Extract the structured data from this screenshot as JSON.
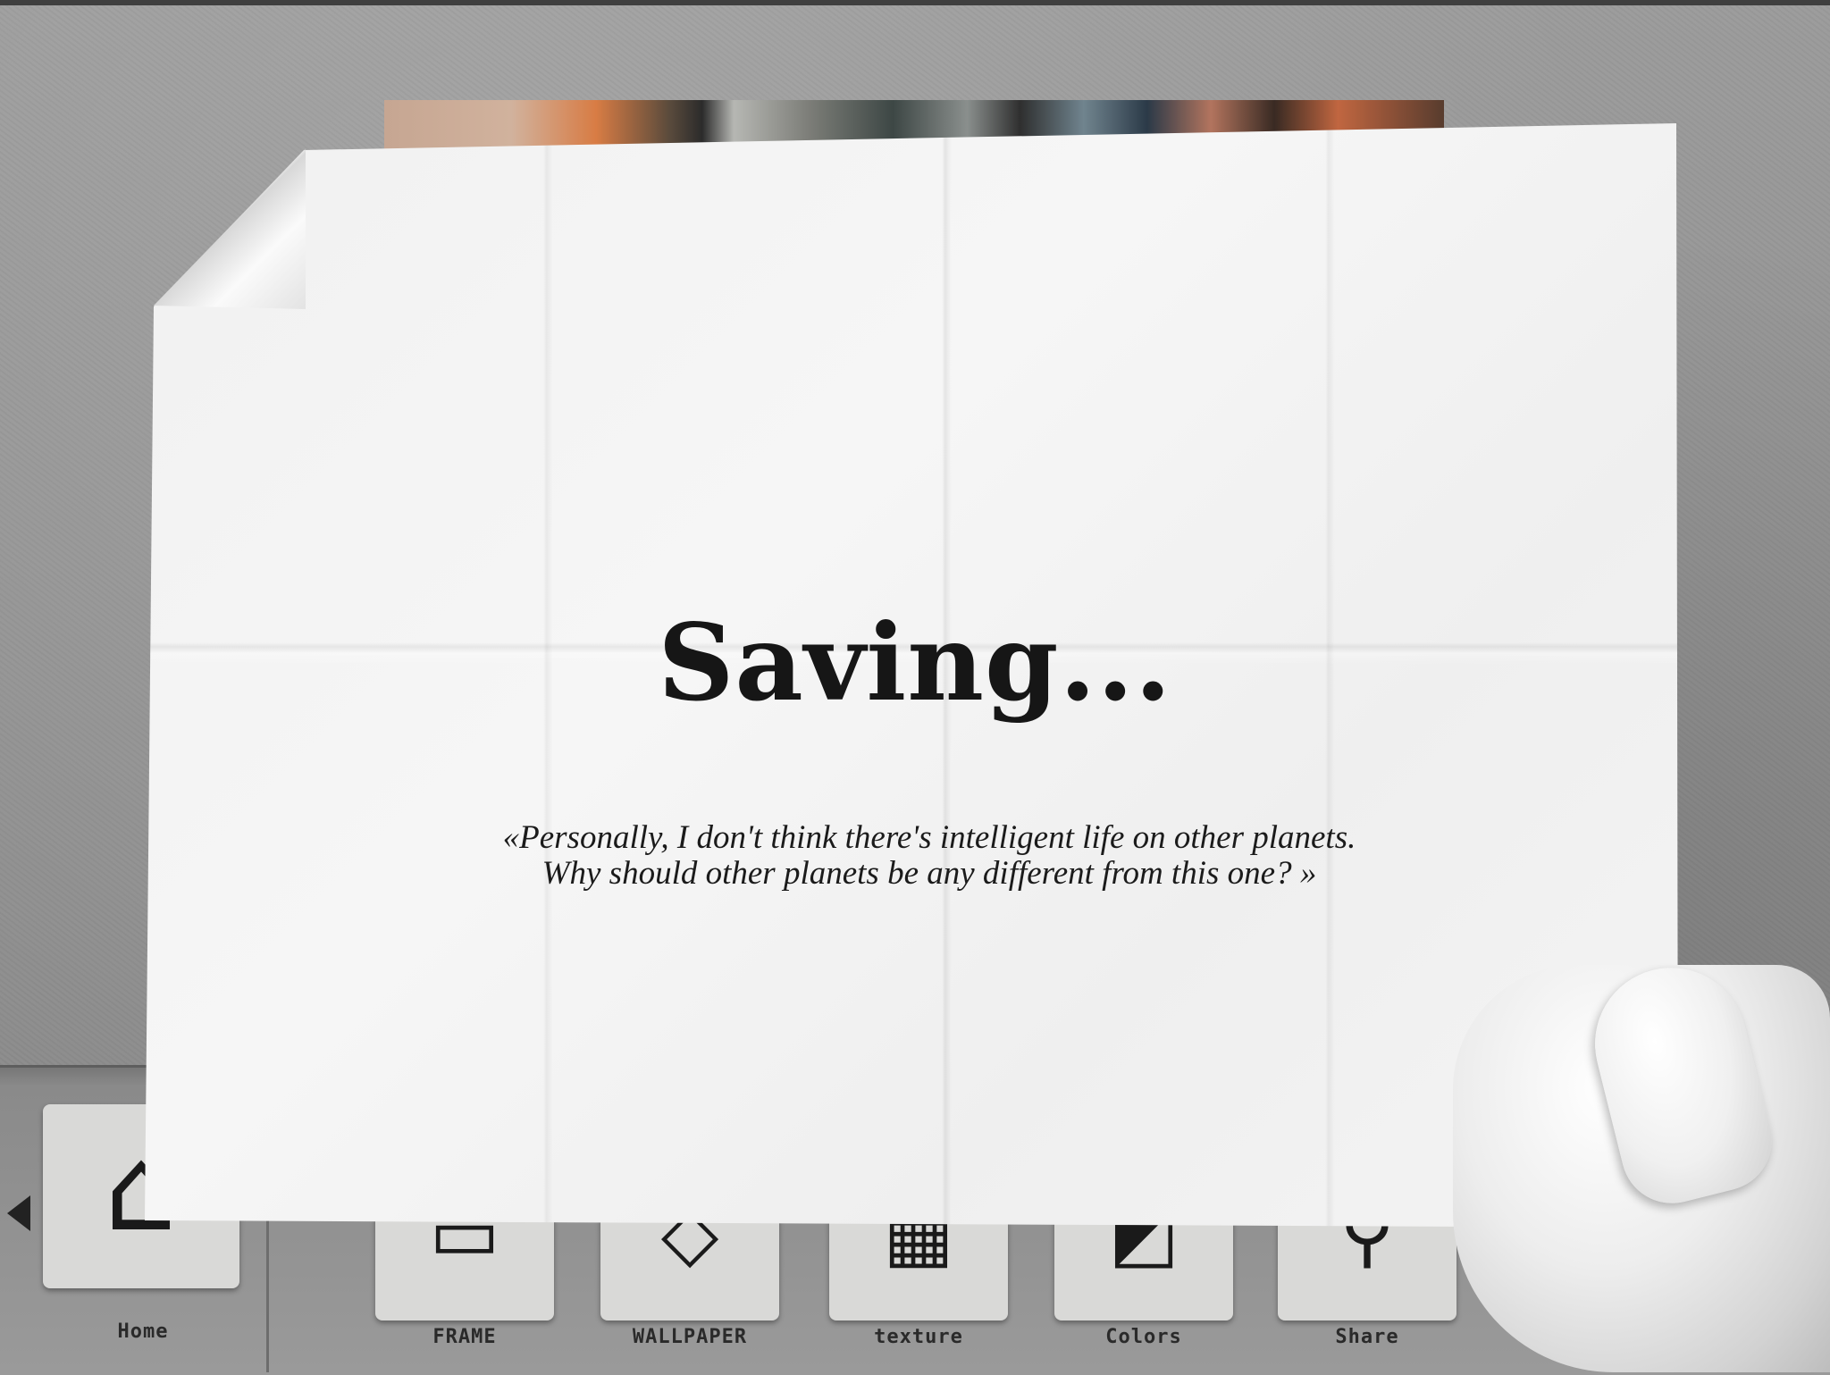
{
  "dialog": {
    "title": "Saving...",
    "quote_line1": "«Personally, I don't think there's intelligent life on other planets.",
    "quote_line2": "Why should other planets be any different from this one? »"
  },
  "toolbar": {
    "items": [
      {
        "label": "Home",
        "icon": "house-icon"
      },
      {
        "label": "FRAME",
        "icon": "frame-icon"
      },
      {
        "label": "WALLPAPER",
        "icon": "wallpaper-icon"
      },
      {
        "label": "texture",
        "icon": "texture-icon"
      },
      {
        "label": "Colors",
        "icon": "colors-icon"
      },
      {
        "label": "Share",
        "icon": "share-icon"
      }
    ]
  }
}
